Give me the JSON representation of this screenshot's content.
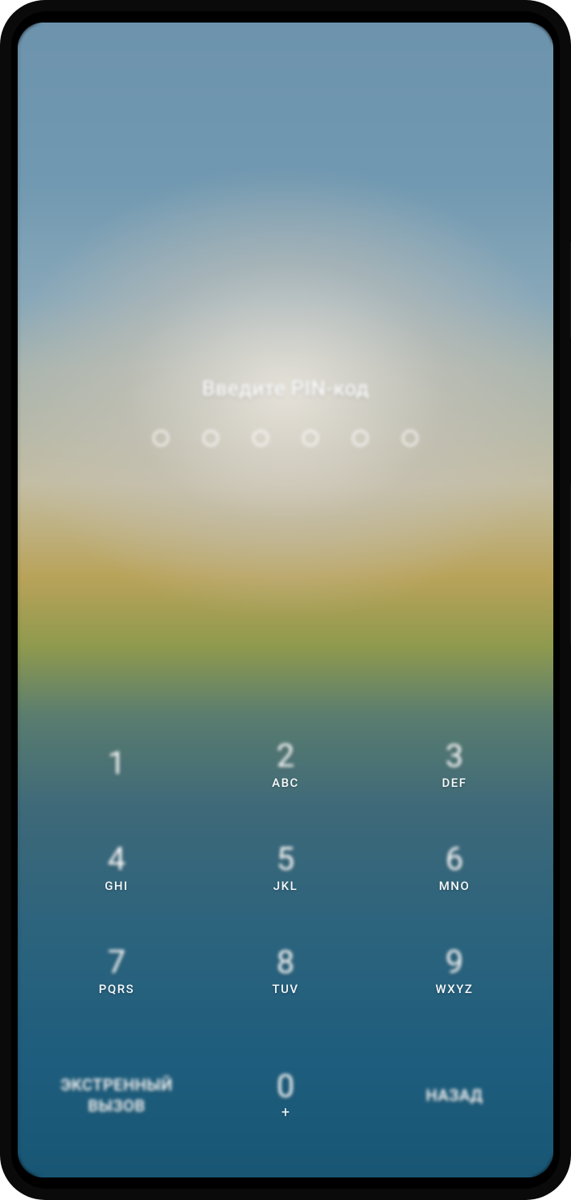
{
  "prompt": "Введите PIN-код",
  "pin_length": 6,
  "keypad": [
    {
      "digit": "1",
      "letters": ""
    },
    {
      "digit": "2",
      "letters": "ABC"
    },
    {
      "digit": "3",
      "letters": "DEF"
    },
    {
      "digit": "4",
      "letters": "GHI"
    },
    {
      "digit": "5",
      "letters": "JKL"
    },
    {
      "digit": "6",
      "letters": "MNO"
    },
    {
      "digit": "7",
      "letters": "PQRS"
    },
    {
      "digit": "8",
      "letters": "TUV"
    },
    {
      "digit": "9",
      "letters": "WXYZ"
    }
  ],
  "zero": {
    "digit": "0",
    "letters": "+"
  },
  "emergency_label_line1": "ЭКСТРЕННЫЙ",
  "emergency_label_line2": "ВЫЗОВ",
  "back_label": "НАЗАД"
}
